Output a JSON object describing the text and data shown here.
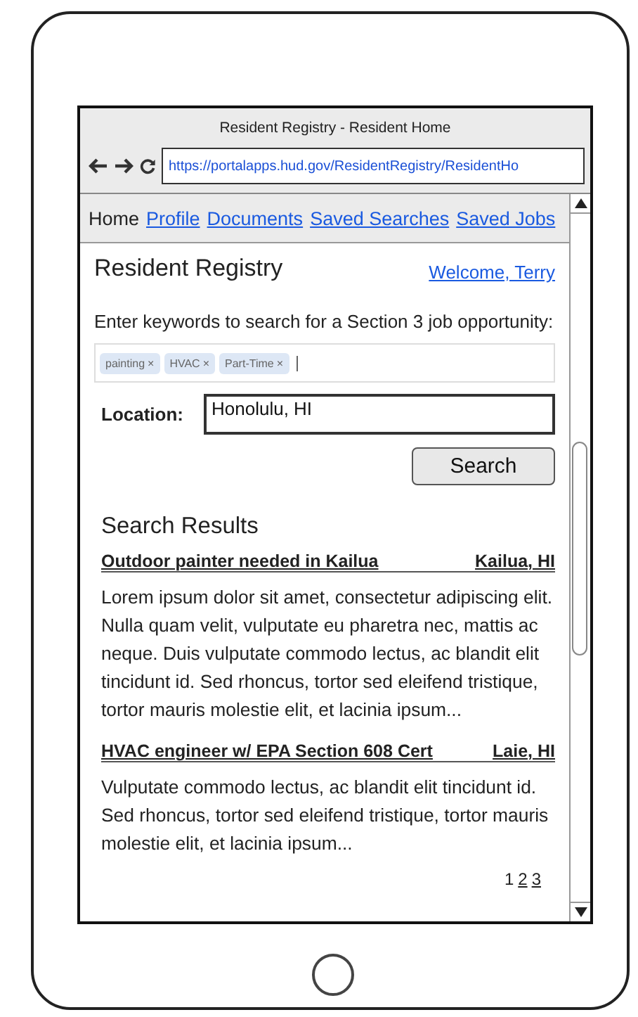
{
  "window": {
    "title": "Resident Registry - Resident Home",
    "url": "https://portalapps.hud.gov/ResidentRegistry/ResidentHo"
  },
  "nav": [
    {
      "label": "Home",
      "selected": true
    },
    {
      "label": "Profile",
      "selected": false
    },
    {
      "label": "Documents",
      "selected": false
    },
    {
      "label": "Saved Searches",
      "selected": false
    },
    {
      "label": "Saved Jobs",
      "selected": false
    }
  ],
  "header": {
    "title": "Resident Registry",
    "welcome": "Welcome, Terry"
  },
  "search": {
    "prompt": "Enter keywords to search for a Section 3 job opportunity:",
    "tags": [
      {
        "label": "painting",
        "remove": "×"
      },
      {
        "label": "HVAC",
        "remove": "×"
      },
      {
        "label": "Part-Time",
        "remove": "×"
      }
    ],
    "location_label": "Location:",
    "location": "Honolulu, HI",
    "button": "Search"
  },
  "results": {
    "title": "Search Results",
    "items": [
      {
        "title": "Outdoor painter needed in Kailua",
        "location": "Kailua, HI",
        "text": "Lorem ipsum dolor sit amet, consectetur adipiscing elit. Nulla quam velit, vulputate eu pharetra nec, mattis ac neque. Duis vulputate commodo lectus, ac blandit elit tincidunt id. Sed rhoncus, tortor sed eleifend tristique, tortor mauris molestie elit, et lacinia ipsum..."
      },
      {
        "title": "HVAC engineer w/ EPA Section 608 Cert",
        "location": "Laie, HI",
        "text": "Vulputate commodo lectus, ac blandit elit tincidunt id. Sed rhoncus, tortor sed eleifend tristique, tortor mauris molestie elit, et lacinia ipsum..."
      }
    ],
    "pages": [
      {
        "label": "1",
        "selected": true
      },
      {
        "label": "2",
        "selected": false
      },
      {
        "label": "3",
        "selected": false
      }
    ]
  }
}
